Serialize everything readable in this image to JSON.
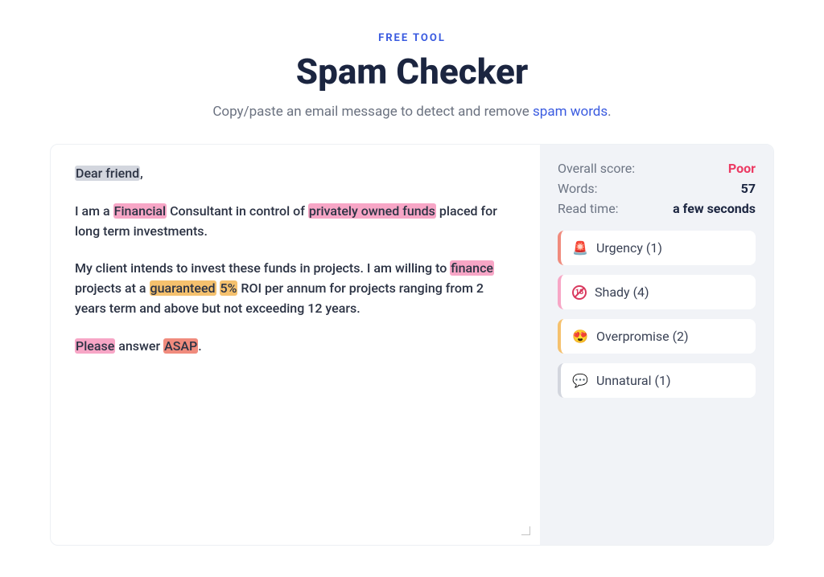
{
  "header": {
    "eyebrow": "FREE TOOL",
    "title": "Spam Checker",
    "subtitle_pre": "Copy/paste an email message to detect and remove ",
    "subtitle_link": "spam words",
    "subtitle_post": "."
  },
  "email": {
    "segments": [
      {
        "text": "Dear friend",
        "cat": "unnatural"
      },
      {
        "text": ",",
        "cat": null
      },
      {
        "break": true
      },
      {
        "text": "  I am a ",
        "cat": null
      },
      {
        "text": "Financial",
        "cat": "shady"
      },
      {
        "text": " Consultant in control of ",
        "cat": null
      },
      {
        "text": "privately owned funds",
        "cat": "shady"
      },
      {
        "text": " placed for long term investments.",
        "cat": null
      },
      {
        "break": true
      },
      {
        "text": "  My client intends to invest these funds in projects. I am willing to ",
        "cat": null
      },
      {
        "text": "finance",
        "cat": "shady"
      },
      {
        "text": " projects at a ",
        "cat": null
      },
      {
        "text": "guaranteed",
        "cat": "over"
      },
      {
        "text": " ",
        "cat": null
      },
      {
        "text": "5%",
        "cat": "over"
      },
      {
        "text": " ROI per annum for projects ranging from 2 years term and above but not exceeding 12 years.",
        "cat": null
      },
      {
        "break": true
      },
      {
        "text": "  ",
        "cat": null
      },
      {
        "text": "Please",
        "cat": "shady"
      },
      {
        "text": " answer ",
        "cat": null
      },
      {
        "text": "ASAP",
        "cat": "urgent"
      },
      {
        "text": ".",
        "cat": null
      }
    ]
  },
  "stats": {
    "overall_label": "Overall score:",
    "overall_value": "Poor",
    "words_label": "Words:",
    "words_value": "57",
    "readtime_label": "Read time:",
    "readtime_value": "a few seconds"
  },
  "categories": [
    {
      "key": "urgency",
      "icon": "siren",
      "label": "Urgency (1)"
    },
    {
      "key": "shady",
      "icon": "no18",
      "label": "Shady (4)"
    },
    {
      "key": "over",
      "icon": "hearts",
      "label": "Overpromise (2)"
    },
    {
      "key": "unnatural",
      "icon": "chat",
      "label": "Unnatural (1)"
    }
  ],
  "icons": {
    "siren": "🚨",
    "hearts": "😍",
    "no18_text": "18",
    "chat": "💬"
  }
}
